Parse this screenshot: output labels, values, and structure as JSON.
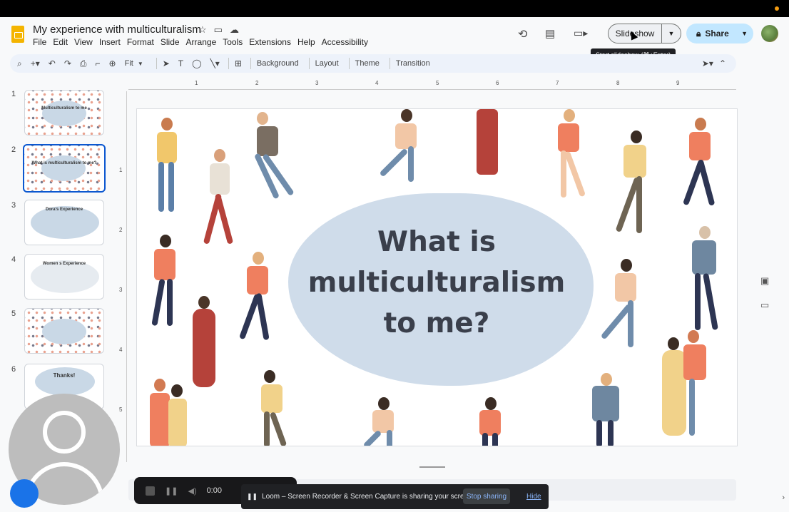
{
  "doc": {
    "title": "My experience with multiculturalism"
  },
  "menu": [
    "File",
    "Edit",
    "View",
    "Insert",
    "Format",
    "Slide",
    "Arrange",
    "Tools",
    "Extensions",
    "Help",
    "Accessibility"
  ],
  "header": {
    "slideshow_label": "Slideshow",
    "share_label": "Share",
    "tooltip": "Start slideshow (⌘+Enter)"
  },
  "toolbar": {
    "zoom": "Fit",
    "background": "Background",
    "layout": "Layout",
    "theme": "Theme",
    "transition": "Transition"
  },
  "ruler": {
    "h": [
      "1",
      "2",
      "3",
      "4",
      "5",
      "6",
      "7",
      "8",
      "9"
    ],
    "v": [
      "1",
      "2",
      "3",
      "4",
      "5"
    ]
  },
  "slides": [
    {
      "num": "1",
      "title": "Multiculturalism to me"
    },
    {
      "num": "2",
      "title": "What is multiculturalism to me?"
    },
    {
      "num": "3",
      "title": "Dora's Experience"
    },
    {
      "num": "4",
      "title": "Women s Experience"
    },
    {
      "num": "5",
      "title": ""
    },
    {
      "num": "6",
      "title": "Thanks!"
    }
  ],
  "slide": {
    "title": "What is multiculturalism to me?"
  },
  "loom": {
    "time": "0:00",
    "message": "Loom – Screen Recorder & Screen Capture is sharing your screen.",
    "stop_label": "Stop sharing",
    "hide_label": "Hide"
  },
  "colors": {
    "accent": "#0b57d0",
    "share_bg": "#c2e7ff",
    "blob": "#cfdcea"
  }
}
